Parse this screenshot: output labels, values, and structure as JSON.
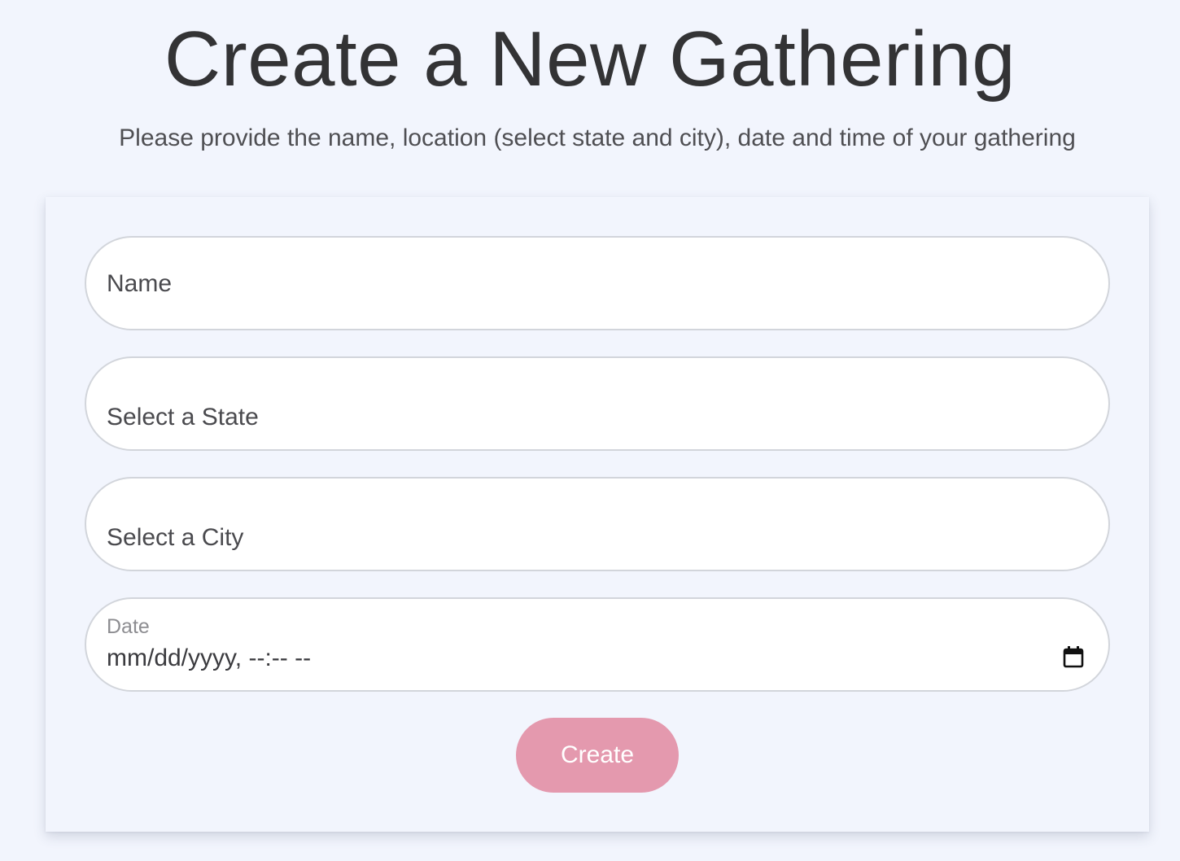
{
  "header": {
    "title": "Create a New Gathering",
    "subtitle": "Please provide the name, location (select state and city), date and time of your gathering"
  },
  "form": {
    "name_placeholder": "Name",
    "state_placeholder": "Select a State",
    "city_placeholder": "Select a City",
    "date_label": "Date",
    "date_placeholder": "mm/dd/yyyy, --:-- --",
    "date_icon": "calendar-icon",
    "submit_label": "Create"
  },
  "colors": {
    "background": "#f2f5fd",
    "button": "#e499ae",
    "button_text": "#ffffff",
    "field_border": "#d2d5db"
  }
}
